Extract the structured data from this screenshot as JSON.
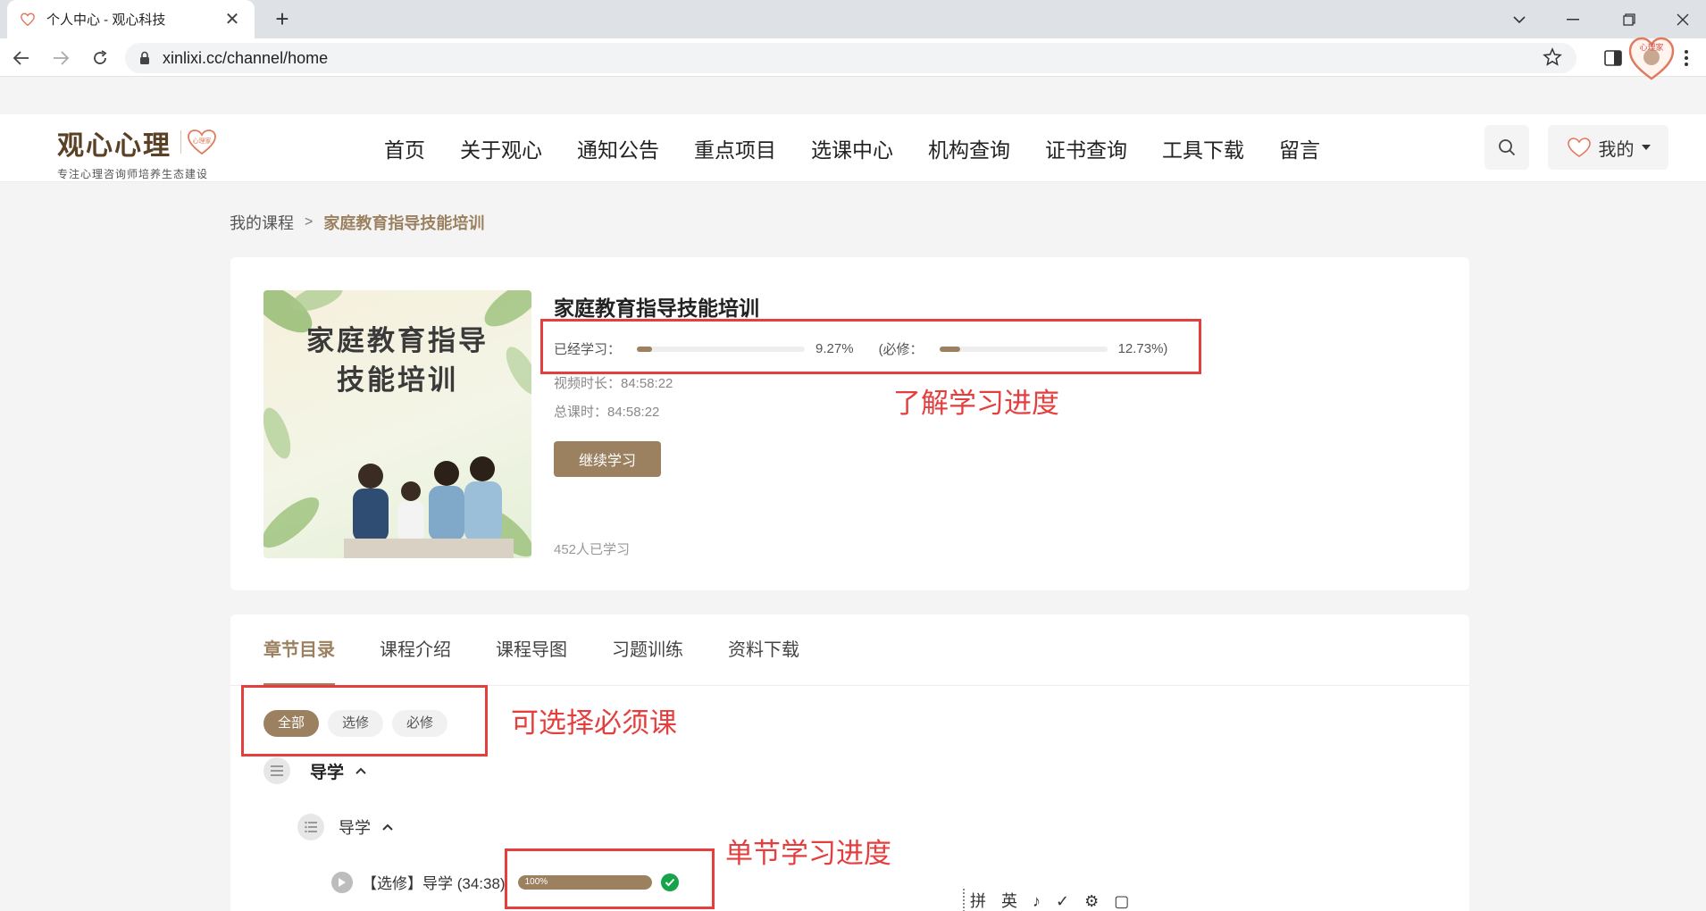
{
  "browser": {
    "tab_title": "个人中心 - 观心科技",
    "url": "xinlixi.cc/channel/home",
    "profile_badge": "心理家"
  },
  "site": {
    "logo_main": "观心心理",
    "logo_sub": "专注心理咨询师培养生态建设",
    "logo_badge": "心理家",
    "nav": [
      "首页",
      "关于观心",
      "通知公告",
      "重点项目",
      "选课中心",
      "机构查询",
      "证书查询",
      "工具下载",
      "留言"
    ],
    "mine_label": "我的"
  },
  "breadcrumb": {
    "root": "我的课程",
    "separator": ">",
    "current": "家庭教育指导技能培训"
  },
  "course": {
    "cover_line1": "家庭教育指导",
    "cover_line2": "技能培训",
    "title": "家庭教育指导技能培训",
    "progress_label": "已经学习：",
    "progress_value": "9.27%",
    "progress_fraction": 0.0927,
    "required_label": "(必修：",
    "required_value": "12.73%)",
    "required_fraction": 0.1273,
    "video_duration": "视频时长：84:58:22",
    "total_duration": "总课时：84:58:22",
    "continue_button": "继续学习",
    "learners": "452人已学习"
  },
  "chapters": {
    "tabs": [
      "章节目录",
      "课程介绍",
      "课程导图",
      "习题训练",
      "资料下载"
    ],
    "filters": [
      "全部",
      "选修",
      "必修"
    ],
    "section_title": "导学",
    "subsection_title": "导学",
    "lesson": {
      "label": "【选修】导学 (34:38)",
      "progress_text": "100%",
      "progress_fraction": 1.0
    }
  },
  "annotations": {
    "progress_note": "了解学习进度",
    "filter_note": "可选择必须课",
    "lesson_note": "单节学习进度"
  },
  "ime_toolbar": "拼 英 ♪ ✓ ⚙ ▢",
  "colors": {
    "accent": "#9b8160",
    "annotation": "#e53e3e",
    "complete": "#16a34a"
  }
}
